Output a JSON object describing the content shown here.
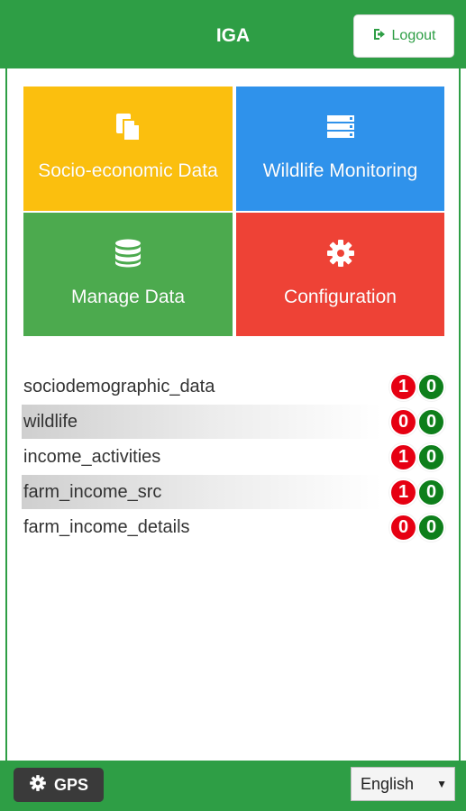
{
  "header": {
    "title": "IGA",
    "logout_label": "Logout",
    "logout_icon": "sign-out-icon"
  },
  "tiles": [
    {
      "label": "Socio-economic Data",
      "icon": "document-copy-icon",
      "color": "#fbbf0e"
    },
    {
      "label": "Wildlife Monitoring",
      "icon": "server-stack-icon",
      "color": "#2f92eb"
    },
    {
      "label": "Manage Data",
      "icon": "database-icon",
      "color": "#4caa4e"
    },
    {
      "label": "Configuration",
      "icon": "gear-icon",
      "color": "#ee4236"
    }
  ],
  "data_rows": [
    {
      "label": "sociodemographic_data",
      "red_count": "1",
      "green_count": "0"
    },
    {
      "label": "wildlife",
      "red_count": "0",
      "green_count": "0"
    },
    {
      "label": "income_activities",
      "red_count": "1",
      "green_count": "0"
    },
    {
      "label": "farm_income_src",
      "red_count": "1",
      "green_count": "0"
    },
    {
      "label": "farm_income_details",
      "red_count": "0",
      "green_count": "0"
    }
  ],
  "footer": {
    "gps_label": "GPS",
    "gps_icon": "gear-icon",
    "language_selected": "English"
  },
  "colors": {
    "brand_green": "#2e9e45",
    "badge_red": "#e60012",
    "badge_green": "#0e7f1b"
  }
}
